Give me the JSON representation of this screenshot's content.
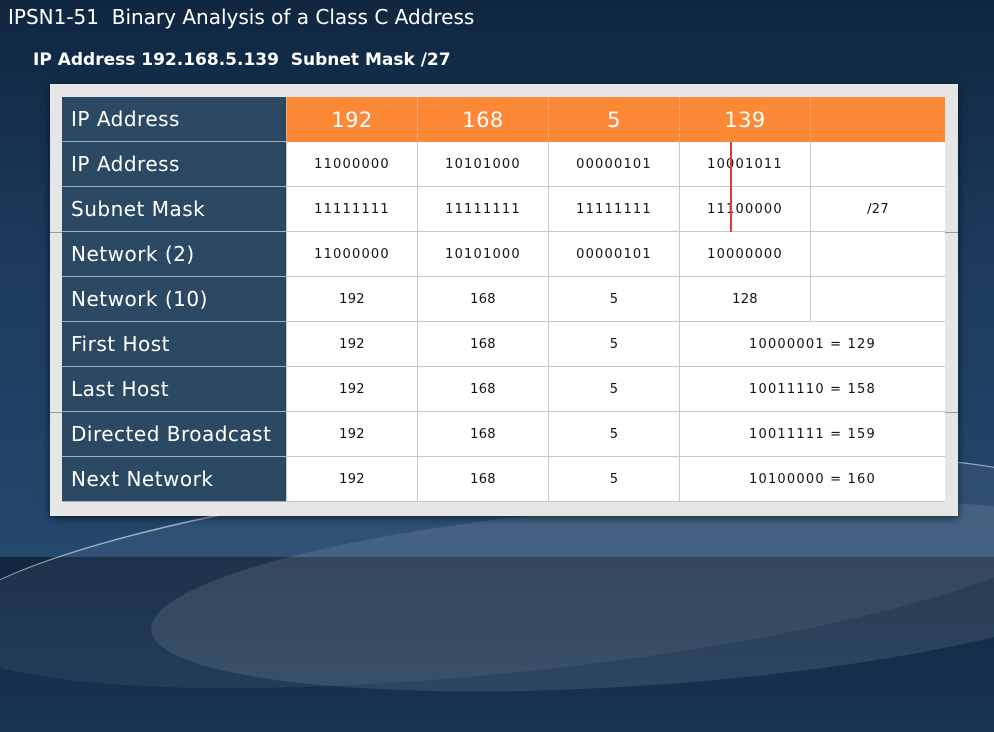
{
  "slide": {
    "title": "IPSN1-51  Binary Analysis of a Class C Address",
    "subtitle": "IP Address 192.168.5.139  Subnet Mask /27"
  },
  "table": {
    "rows": [
      {
        "label": "IP Address",
        "cells": [
          "192",
          "168",
          "5",
          "139",
          ""
        ]
      },
      {
        "label": "IP Address",
        "cells": [
          "11000000",
          "10101000",
          "00000101",
          "10001011",
          ""
        ]
      },
      {
        "label": "Subnet Mask",
        "cells": [
          "11111111",
          "11111111",
          "11111111",
          "11100000",
          "/27"
        ]
      },
      {
        "label": "Network (2)",
        "cells": [
          "11000000",
          "10101000",
          "00000101",
          "10000000",
          ""
        ]
      },
      {
        "label": "Network (10)",
        "cells": [
          "192",
          "168",
          "5",
          "128",
          ""
        ]
      },
      {
        "label": "First Host",
        "cells": [
          "192",
          "168",
          "5",
          "10000001 = 129"
        ]
      },
      {
        "label": "Last Host",
        "cells": [
          "192",
          "168",
          "5",
          "10011110 = 158"
        ]
      },
      {
        "label": "Directed Broadcast",
        "cells": [
          "192",
          "168",
          "5",
          "10011111 = 159"
        ]
      },
      {
        "label": "Next Network",
        "cells": [
          "192",
          "168",
          "5",
          "10100000 = 160"
        ]
      }
    ]
  },
  "colors": {
    "header_bg": "#fd8836",
    "label_bg": "#2c4964",
    "marker": "#e23a3a"
  }
}
